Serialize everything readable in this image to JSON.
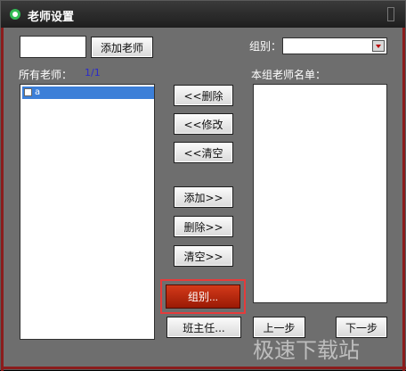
{
  "window": {
    "title": "老师设置"
  },
  "top": {
    "add_teacher_label": "添加老师",
    "group_label": "组别："
  },
  "left": {
    "all_teachers_label": "所有老师：",
    "count": "1/1",
    "items": [
      {
        "label": "a"
      }
    ]
  },
  "right": {
    "list_label": "本组老师名单："
  },
  "buttons": {
    "remove_left": "<<删除",
    "modify_left": "<<修改",
    "clear_left": "<<清空",
    "add_right": "添加>>",
    "remove_right": "删除>>",
    "clear_right": "清空>>",
    "group": "组别...",
    "head_teacher": "班主任...",
    "prev": "上一步",
    "next": "下一步"
  },
  "watermark": "极速下载站",
  "colors": {
    "accent_red": "#c0290f",
    "highlight": "#e53b3b",
    "selection": "#3c7fd8"
  }
}
